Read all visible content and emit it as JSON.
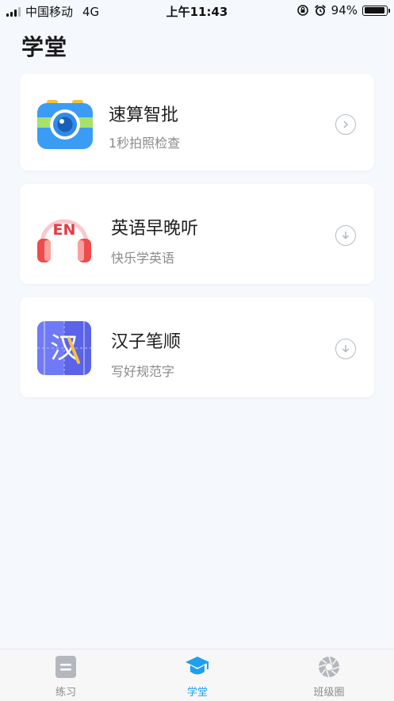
{
  "status_bar": {
    "carrier": "中国移动",
    "network": "4G",
    "time": "上午11:43",
    "battery": "94%",
    "battery_level": 0.94
  },
  "page": {
    "title": "学堂"
  },
  "cards": [
    {
      "title": "速算智批",
      "subtitle": "1秒拍照检查",
      "action": "chevron-right-icon"
    },
    {
      "title": "英语早晚听",
      "subtitle": "快乐学英语",
      "icon_text": "EN",
      "action": "download-icon"
    },
    {
      "title": "汉子笔顺",
      "subtitle": "写好规范字",
      "icon_text": "汉",
      "action": "download-icon"
    }
  ],
  "tabbar": {
    "active": 1,
    "tabs": [
      {
        "label": "练习"
      },
      {
        "label": "学堂"
      },
      {
        "label": "班级圈"
      }
    ]
  },
  "colors": {
    "accent": "#1ea0ef",
    "background": "#f5f8fc",
    "card_bg": "#ffffff",
    "muted_text": "#8a8a8a"
  }
}
